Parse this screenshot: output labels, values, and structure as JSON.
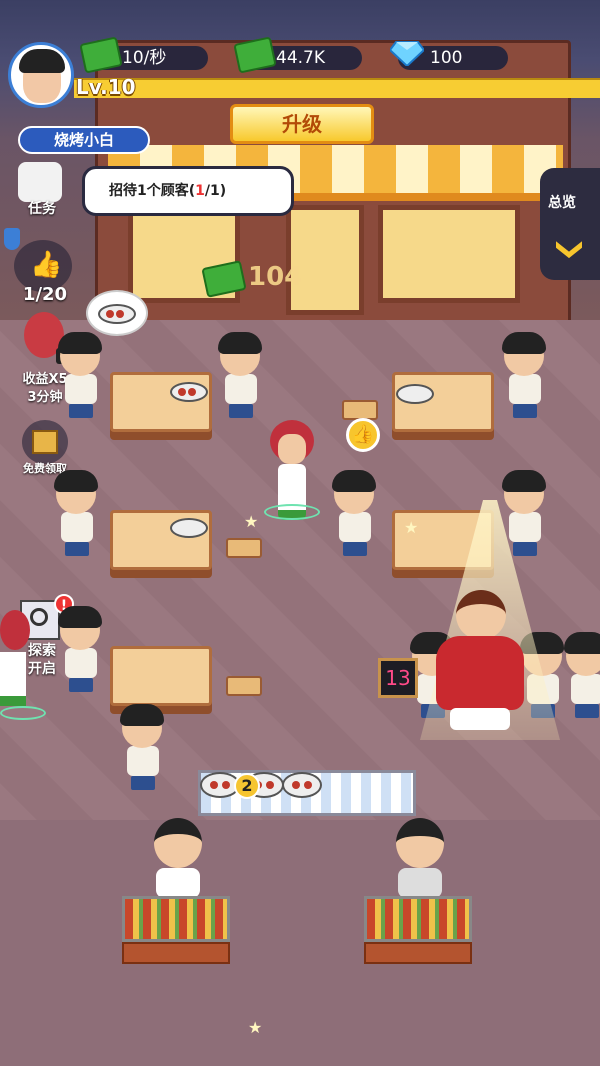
{
  "hud": {
    "income_rate": "10/秒",
    "money": "44.7K",
    "gems": "100",
    "level": "Lv.10",
    "upgrade_label": "升级",
    "player_title": "烧烤小白"
  },
  "side": {
    "task_label": "任务",
    "like_count": "1/20",
    "income_boost_label": "收益X5",
    "income_boost_time": "3分钟",
    "free_claim_label": "免费领取",
    "explore_label_1": "探索",
    "explore_label_2": "开启",
    "explore_alert": "!"
  },
  "task": {
    "text_prefix": "招待1个顾客(",
    "progress_current": "1",
    "text_suffix": "/1)"
  },
  "overview": {
    "label": "总览"
  },
  "scene": {
    "floating_number": "104",
    "counter_badge": "2",
    "queue_board": "13"
  }
}
